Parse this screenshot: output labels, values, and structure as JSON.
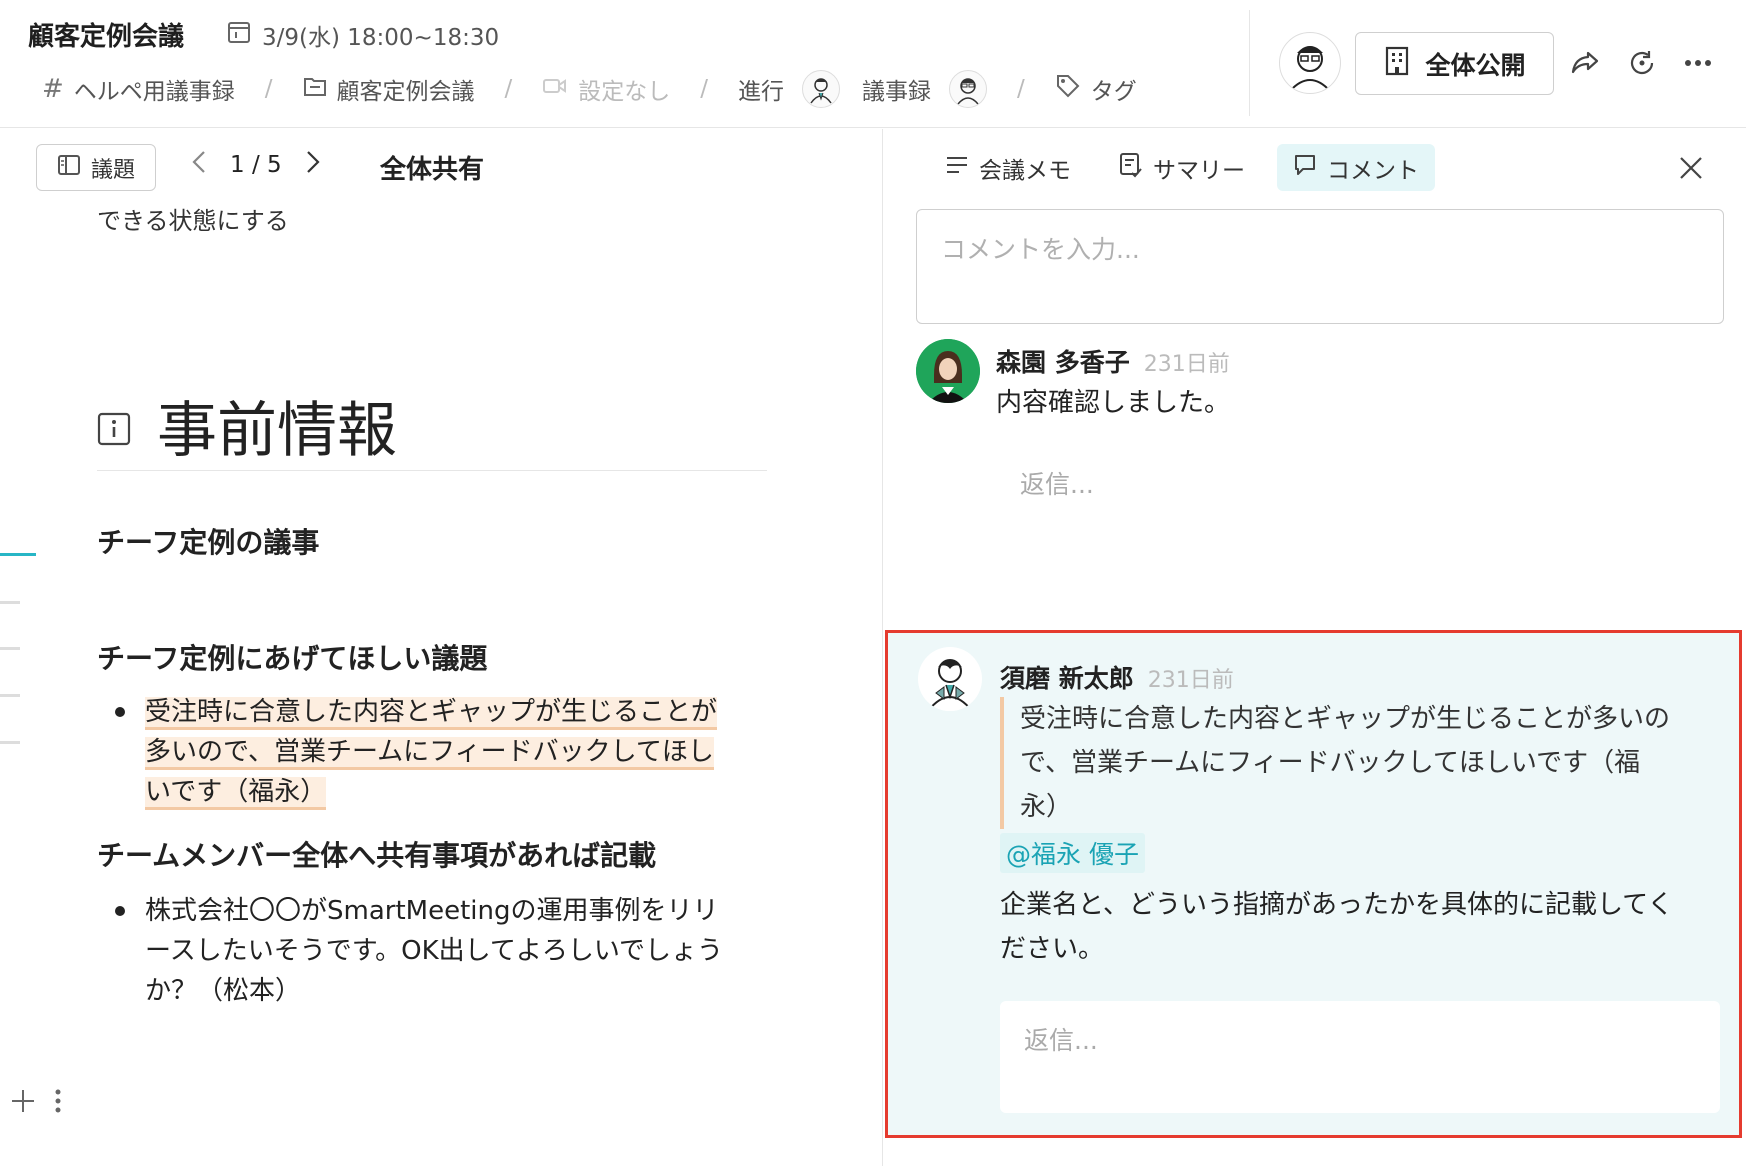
{
  "header": {
    "title": "顧客定例会議",
    "datetime": "3/9(水) 18:00~18:30",
    "breadcrumbs": {
      "channel": "ヘルペ用議事録",
      "folder": "顧客定例会議",
      "video": "設定なし",
      "facilitator_label": "進行",
      "minutes_label": "議事録",
      "tag_label": "タグ"
    },
    "public_button": "全体公開"
  },
  "left": {
    "agenda_button": "議題",
    "pager": "1 / 5",
    "section_title": "全体共有",
    "doc_top_text": "できる状態にする",
    "heading": "事前情報",
    "subheadings": [
      "チーフ定例の議事",
      "チーフ定例にあげてほしい議題",
      "チームメンバー全体へ共有事項があれば記載"
    ],
    "bullet1_lines": [
      "受注時に合意した内容とギャップが生じることが",
      "多いので、営業チームにフィードバックしてほし",
      "いです（福永）"
    ],
    "bullet2_lines": [
      "株式会社〇〇がSmartMeetingの運用事例をリリ",
      "ースしたいそうです。OK出してよろしいでしょう",
      "か？（松本）"
    ]
  },
  "right": {
    "tabs": [
      "会議メモ",
      "サマリー",
      "コメント"
    ],
    "comment_placeholder": "コメントを入力...",
    "comments": [
      {
        "author": "森園 多香子",
        "time": "231日前",
        "body": "内容確認しました。",
        "reply_placeholder": "返信..."
      },
      {
        "author": "須磨 新太郎",
        "time": "231日前",
        "quote_lines": [
          "受注時に合意した内容とギャップが生じることが多いの",
          "で、営業チームにフィードバックしてほしいです（福",
          "永）"
        ],
        "mention": "@福永 優子",
        "body_lines": [
          "企業名と、どういう指摘があったかを具体的に記載してく",
          "ださい。"
        ],
        "reply_placeholder": "返信..."
      }
    ]
  },
  "colors": {
    "accent": "#27b6c6",
    "highlight_border": "#e53b2f",
    "quote_bar": "#f3c9a4"
  }
}
